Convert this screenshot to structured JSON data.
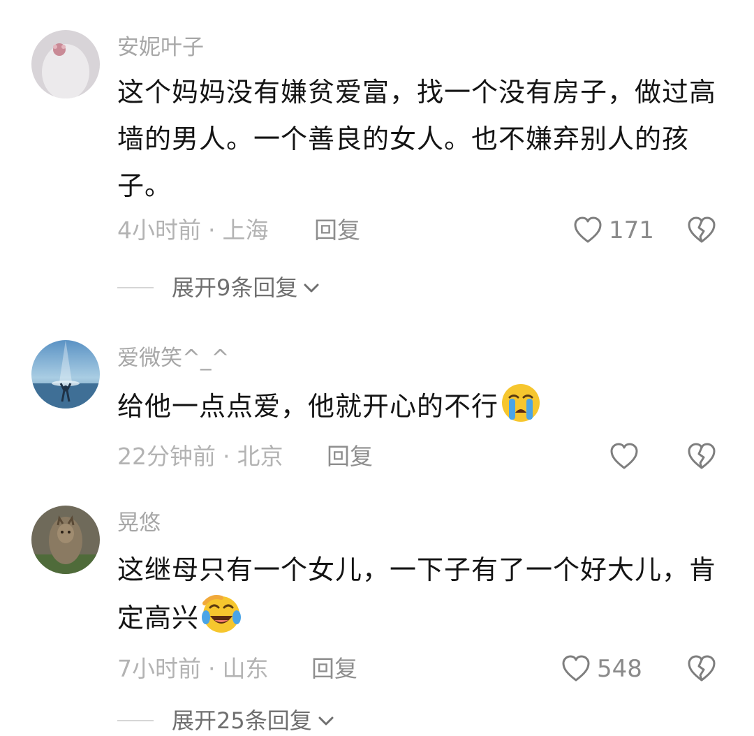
{
  "comments": [
    {
      "username": "安妮叶子",
      "avatar_icon": "avatar-icon",
      "text": "这个妈妈没有嫌贫爱富，找一个没有房子，做过高墙的男人。一个善良的女人。也不嫌弃别人的孩子。",
      "time": "4小时前",
      "location": "上海",
      "reply_label": "回复",
      "like_count": "171",
      "expand_label": "展开9条回复"
    },
    {
      "username": "爱微笑^_^",
      "avatar_icon": "avatar-icon",
      "text": "给他一点点爱，他就开心的不行",
      "emoji": "loudly-crying-face-icon",
      "time": "22分钟前",
      "location": "北京",
      "reply_label": "回复",
      "like_count": ""
    },
    {
      "username": "晃悠",
      "avatar_icon": "avatar-icon",
      "text": "这继母只有一个女儿，一下子有了一个好大儿，肯定高兴",
      "emoji": "tears-of-joy-face-icon",
      "time": "7小时前",
      "location": "山东",
      "reply_label": "回复",
      "like_count": "548",
      "expand_label": "展开25条回复"
    }
  ],
  "separator": "·",
  "colors": {
    "meta": "#b3b3b3",
    "username": "#a7a7a7",
    "text": "#141414"
  }
}
